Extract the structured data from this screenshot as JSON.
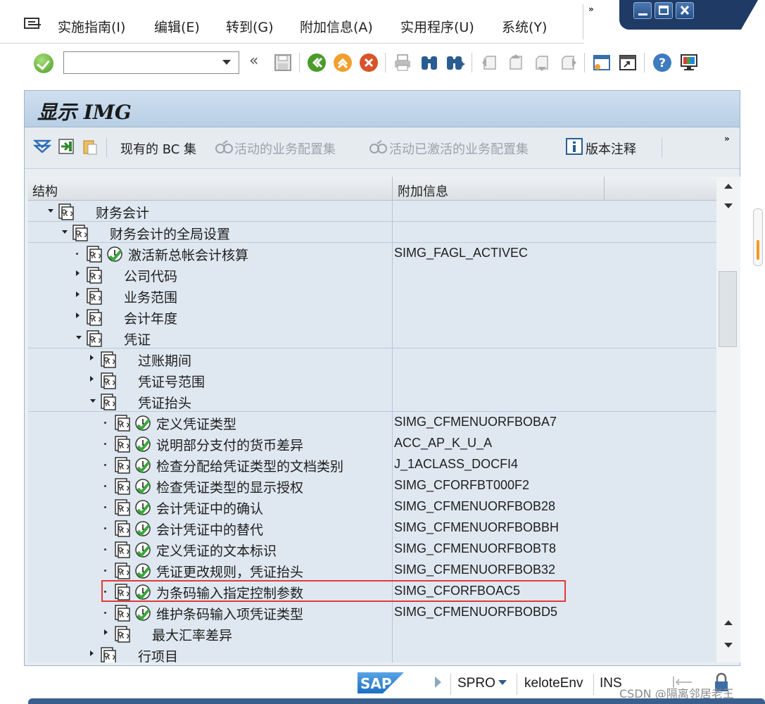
{
  "menu": {
    "items": [
      "实施指南(I)",
      "编辑(E)",
      "转到(G)",
      "附加信息(A)",
      "实用程序(U)",
      "系统(Y)"
    ],
    "more": "»"
  },
  "toolbar": {
    "command_value": "",
    "back_label": "«",
    "icons": [
      "enter-icon",
      "save-icon",
      "back-icon",
      "exit-icon",
      "cancel-icon",
      "print-icon",
      "find-icon",
      "find-next-icon",
      "first-page-icon",
      "previous-page-icon",
      "next-page-icon",
      "last-page-icon",
      "new-session-icon",
      "shortcut-icon",
      "help-icon",
      "customize-layout-icon"
    ]
  },
  "panel": {
    "title": "显示 IMG",
    "app_toolbar": {
      "existing_bc_sets": "现有的 BC 集",
      "active_bc_sets": "活动的业务配置集",
      "activated_bc_sets": "活动已激活的业务配置集",
      "release_notes": "版本注释",
      "more": "»"
    }
  },
  "tree": {
    "col_structure": "结构",
    "col_info": "附加信息",
    "rows": [
      {
        "indent": 0,
        "state": "expanded",
        "exec": false,
        "label": "财务会计",
        "info": ""
      },
      {
        "indent": 1,
        "state": "expanded",
        "exec": false,
        "label": "财务会计的全局设置",
        "info": ""
      },
      {
        "indent": 2,
        "state": "leaf",
        "exec": true,
        "label": "激活新总帐会计核算",
        "info": "SIMG_FAGL_ACTIVEC"
      },
      {
        "indent": 2,
        "state": "collapsed",
        "exec": false,
        "label": "公司代码",
        "info": ""
      },
      {
        "indent": 2,
        "state": "collapsed",
        "exec": false,
        "label": "业务范围",
        "info": ""
      },
      {
        "indent": 2,
        "state": "collapsed",
        "exec": false,
        "label": "会计年度",
        "info": ""
      },
      {
        "indent": 2,
        "state": "expanded",
        "exec": false,
        "label": "凭证",
        "info": ""
      },
      {
        "indent": 3,
        "state": "collapsed",
        "exec": false,
        "label": "过账期间",
        "info": ""
      },
      {
        "indent": 3,
        "state": "collapsed",
        "exec": false,
        "label": "凭证号范围",
        "info": ""
      },
      {
        "indent": 3,
        "state": "expanded",
        "exec": false,
        "label": "凭证抬头",
        "info": ""
      },
      {
        "indent": 4,
        "state": "leaf",
        "exec": true,
        "label": "定义凭证类型",
        "info": "SIMG_CFMENUORFBOBA7"
      },
      {
        "indent": 4,
        "state": "leaf",
        "exec": true,
        "label": "说明部分支付的货币差异",
        "info": "ACC_AP_K_U_A"
      },
      {
        "indent": 4,
        "state": "leaf",
        "exec": true,
        "label": "检查分配给凭证类型的文档类别",
        "info": "J_1ACLASS_DOCFI4"
      },
      {
        "indent": 4,
        "state": "leaf",
        "exec": true,
        "label": "检查凭证类型的显示授权",
        "info": "SIMG_CFORFBT000F2"
      },
      {
        "indent": 4,
        "state": "leaf",
        "exec": true,
        "label": "会计凭证中的确认",
        "info": "SIMG_CFMENUORFBOB28"
      },
      {
        "indent": 4,
        "state": "leaf",
        "exec": true,
        "label": "会计凭证中的替代",
        "info": "SIMG_CFMENUORFBOBBH"
      },
      {
        "indent": 4,
        "state": "leaf",
        "exec": true,
        "label": "定义凭证的文本标识",
        "info": "SIMG_CFMENUORFBOBT8"
      },
      {
        "indent": 4,
        "state": "leaf",
        "exec": true,
        "label": "凭证更改规则，凭证抬头",
        "info": "SIMG_CFMENUORFBOB32"
      },
      {
        "indent": 4,
        "state": "leaf",
        "exec": true,
        "label": "为条码输入指定控制参数",
        "info": "SIMG_CFORFBOAC5"
      },
      {
        "indent": 4,
        "state": "leaf",
        "exec": true,
        "label": "维护条码输入项凭证类型",
        "info": "SIMG_CFMENUORFBOBD5"
      },
      {
        "indent": 4,
        "state": "collapsed",
        "exec": false,
        "label": "最大汇率差异",
        "info": ""
      },
      {
        "indent": 3,
        "state": "collapsed",
        "exec": false,
        "label": "行项目",
        "info": ""
      }
    ]
  },
  "status": {
    "logo": "SAP",
    "transaction": "SPRO",
    "system": "keloteEnv",
    "mode": "INS"
  },
  "watermark": "CSDN @隔离邻居老王",
  "colors": {
    "highlight": "#e03a3a",
    "title_bar": "#c2d6ea",
    "tree_bg": "#dfe8f1"
  }
}
